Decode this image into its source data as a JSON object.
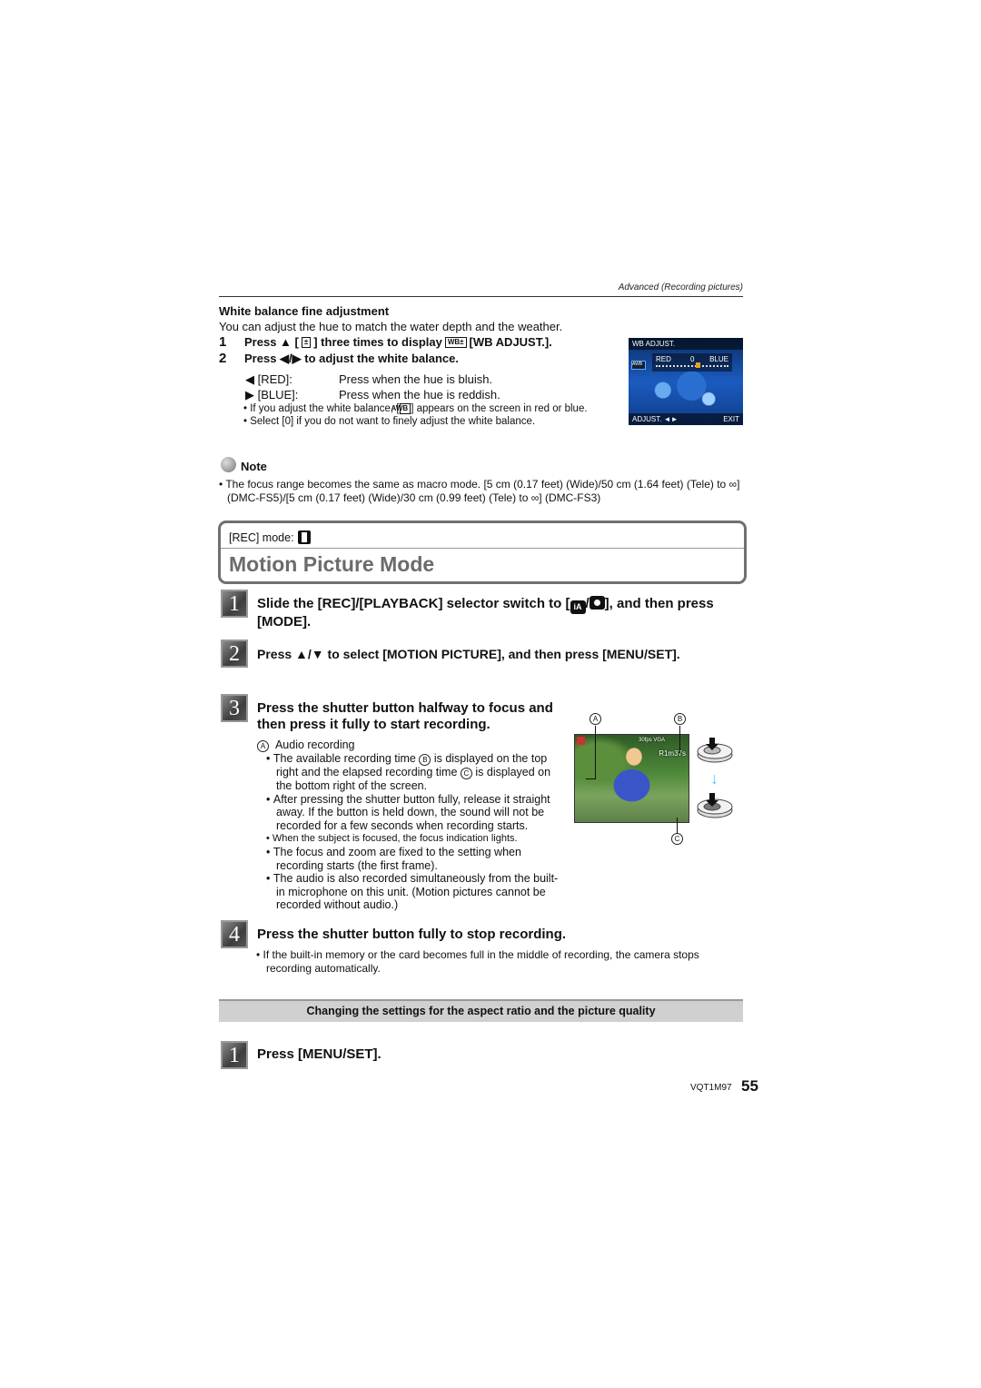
{
  "header": {
    "section_label": "Advanced (Recording pictures)"
  },
  "white_balance": {
    "title": "White balance fine adjustment",
    "intro": "You can adjust the hue to match the water depth and the weather.",
    "steps": [
      {
        "num": "1",
        "pre": "Press ▲ [",
        "icon": "±",
        "mid": "] three times to display ",
        "icon2": "WB±",
        "post": " [WB ADJUST.]."
      },
      {
        "num": "2",
        "text": "Press ◀/▶ to adjust the white balance."
      }
    ],
    "options": [
      {
        "key": "◀ [RED]:",
        "desc": "Press when the hue is bluish."
      },
      {
        "key": "▶ [BLUE]:",
        "desc": "Press when the hue is reddish."
      }
    ],
    "bullets": [
      {
        "pre": "• If you adjust the white balance, [",
        "icon": "AWB",
        "post": "] appears on the screen in red or blue."
      },
      {
        "text": "• Select [0] if you do not want to finely adjust the white balance."
      }
    ],
    "screen": {
      "title": "WB ADJUST.",
      "left_label": "RED",
      "center_value": "0",
      "right_label": "BLUE",
      "awb": "AWB",
      "bottom_left": "ADJUST. ◄►",
      "bottom_right": "EXIT"
    }
  },
  "note": {
    "label": "Note",
    "text": "• The focus range becomes the same as macro mode. [5 cm (0.17 feet) (Wide)/50 cm (1.64 feet) (Tele) to ∞] (DMC-FS5)/[5 cm (0.17 feet) (Wide)/30 cm (0.99 feet) (Tele) to ∞] (DMC-FS3)"
  },
  "mode_box": {
    "rec_mode_label": "[REC] mode:",
    "title": "Motion Picture Mode"
  },
  "steps": [
    {
      "num": "1",
      "pre": "Slide the [REC]/[PLAYBACK] selector switch to [",
      "icon_a": "iA",
      "sep": "/",
      "post": "], and then press [MODE]."
    },
    {
      "num": "2",
      "text": "Press ▲/▼ to select [MOTION PICTURE], and then press [MENU/SET]."
    },
    {
      "num": "3",
      "text": "Press the shutter button halfway to focus and then press it fully to start recording.",
      "legend_a": "Audio recording",
      "bullets": [
        {
          "pre": "The available recording time ",
          "mark_b": "B",
          "mid": " is displayed on the top right and the elapsed recording time ",
          "mark_c": "C",
          "post": " is displayed on the bottom right of the screen."
        },
        {
          "text": "After pressing the shutter button fully, release it straight away. If the button is held down, the sound will not be recorded for a few seconds when recording starts."
        },
        {
          "text": "When the subject is focused, the focus indication lights."
        },
        {
          "text": "The focus and zoom are fixed to the setting when recording starts (the first frame)."
        },
        {
          "text": "The audio is also recorded simultaneously from the built-in microphone on this unit. (Motion pictures cannot be recorded without audio.)"
        }
      ]
    },
    {
      "num": "4",
      "text": "Press the shutter button fully to stop recording.",
      "bullet": "If the built-in memory or the card becomes full in the middle of recording, the camera stops recording automatically."
    }
  ],
  "figure": {
    "label_a": "A",
    "label_b": "B",
    "label_c": "C",
    "hud_time": "R1m37s",
    "hud_quality": "30fps VGA"
  },
  "settings_bar": {
    "title": "Changing the settings for the aspect ratio and the picture quality"
  },
  "settings_step": {
    "num": "1",
    "text": "Press [MENU/SET]."
  },
  "footer": {
    "code": "VQT1M97",
    "page": "55"
  }
}
